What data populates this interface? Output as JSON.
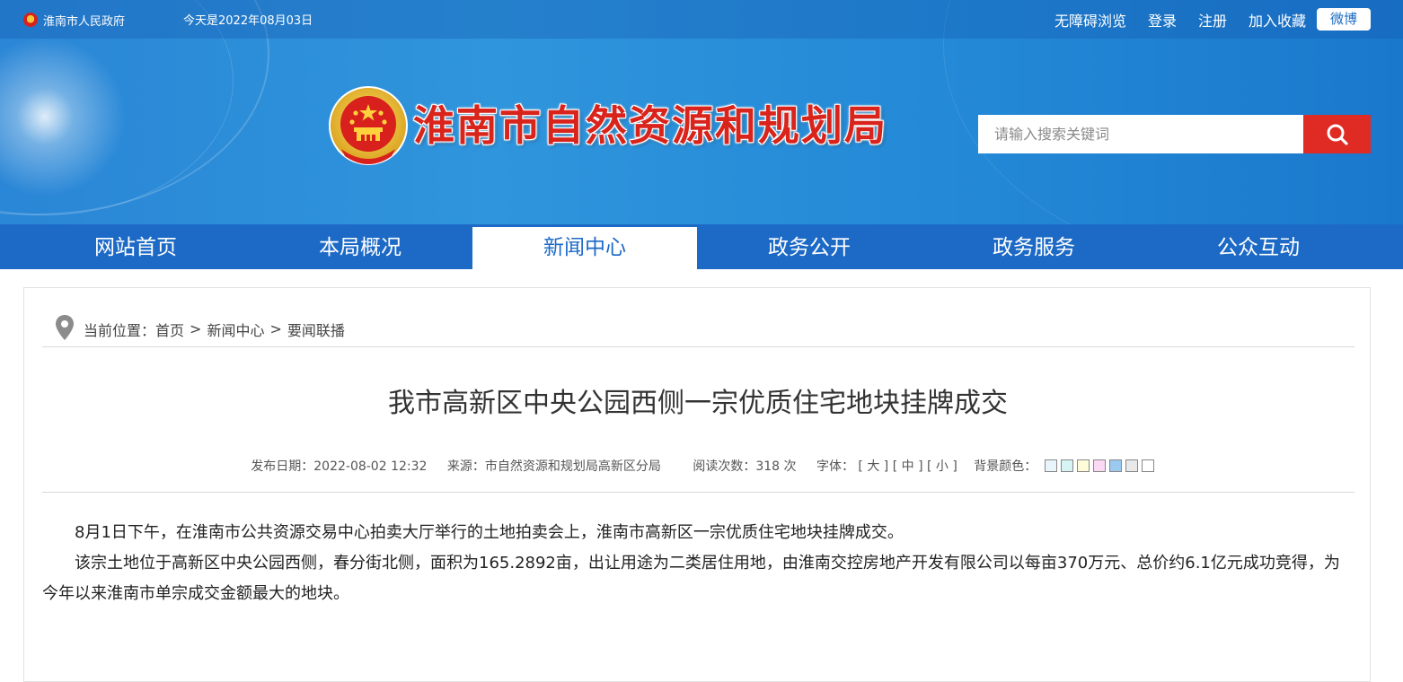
{
  "topbar": {
    "gov_link": "淮南市人民政府",
    "date": "今天是2022年08月03日",
    "links": [
      "无障碍浏览",
      "登录",
      "注册",
      "加入收藏"
    ],
    "weibo": "微博"
  },
  "header": {
    "site_title": "淮南市自然资源和规划局",
    "search_placeholder": "请输入搜索关键词",
    "search_icon": "magnifier-icon"
  },
  "nav": {
    "items": [
      "网站首页",
      "本局概况",
      "新闻中心",
      "政务公开",
      "政务服务",
      "公众互动"
    ],
    "active": "新闻中心"
  },
  "breadcrumb": {
    "prefix": "当前位置：",
    "items": [
      "首页",
      "新闻中心",
      "要闻联播"
    ],
    "separator": ">"
  },
  "article": {
    "title": "我市高新区中央公园西侧一宗优质住宅地块挂牌成交",
    "meta": {
      "published": "发布日期：2022-08-02 12:32",
      "source": "来源：市自然资源和规划局高新区分局",
      "reads": "阅读次数：318 次",
      "font_label": "字体：",
      "font_large": "[ 大 ]",
      "font_medium": "[ 中 ]",
      "font_small": "[ 小 ]",
      "bg_label": "背景颜色：",
      "bg_colors": [
        "#e8f6fb",
        "#d6f4f4",
        "#fdfbd8",
        "#fbd9f5",
        "#9cc9f0",
        "#e9e9e9",
        "#ffffff"
      ]
    },
    "paragraphs": [
      "8月1日下午，在淮南市公共资源交易中心拍卖大厅举行的土地拍卖会上，淮南市高新区一宗优质住宅地块挂牌成交。",
      "该宗土地位于高新区中央公园西侧，春分街北侧，面积为165.2892亩，出让用途为二类居住用地，由淮南交控房地产开发有限公司以每亩370万元、总价约6.1亿元成功竞得，为今年以来淮南市单宗成交金额最大的地块。"
    ]
  },
  "colors": {
    "nav_blue": "#1d6ac6",
    "title_red": "#d9241c",
    "search_red": "#e02a24"
  }
}
